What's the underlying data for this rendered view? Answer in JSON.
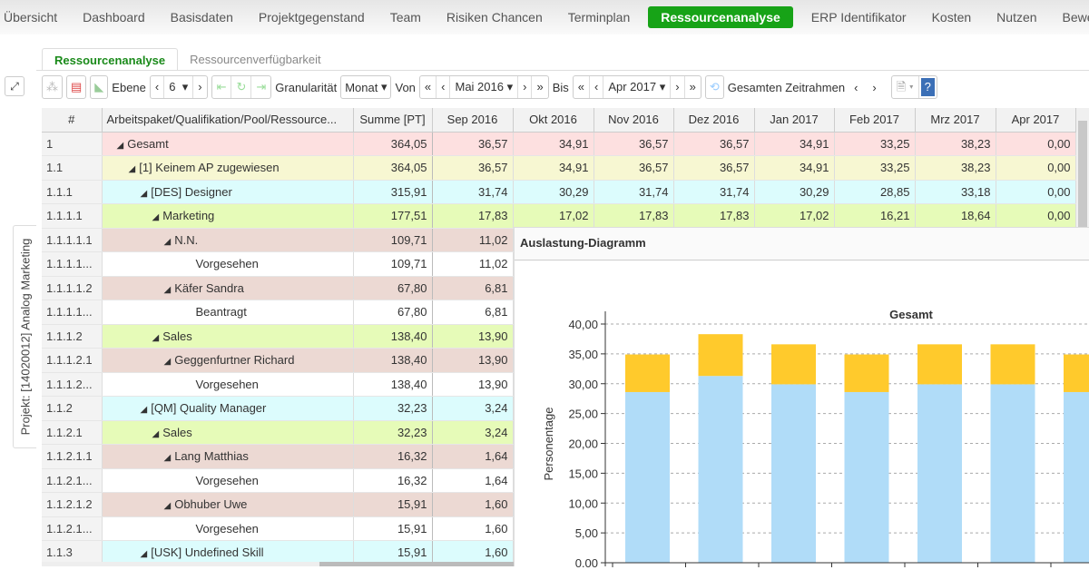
{
  "nav": {
    "items": [
      "Übersicht",
      "Dashboard",
      "Basisdaten",
      "Projektgegenstand",
      "Team",
      "Risiken Chancen",
      "Terminplan",
      "Ressourcenanalyse",
      "ERP Identifikator",
      "Kosten",
      "Nutzen",
      "Bewertung"
    ],
    "active": "Ressourcenanalyse",
    "accent": "#17a317"
  },
  "subtabs": [
    "Ressourcenanalyse",
    "Ressourcenverfügbarkeit"
  ],
  "toolbar": {
    "ebene_label": "Ebene",
    "ebene_value": "6",
    "granularitaet_label": "Granularität",
    "granularitaet_value": "Monat",
    "von_label": "Von",
    "von_value": "Mai 2016",
    "bis_label": "Bis",
    "bis_value": "Apr 2017",
    "zeitrahmen_label": "Gesamten Zeitrahmen"
  },
  "side_tab": "Projekt: [14020012] Analog Marketing",
  "table": {
    "headers": [
      "#",
      "Arbeitspaket/Qualifikation/Pool/Ressource...",
      "Summe [PT]",
      "Sep 2016",
      "Okt 2016",
      "Nov 2016",
      "Dez 2016",
      "Jan 2017",
      "Feb 2017",
      "Mrz 2017",
      "Apr 2017"
    ],
    "rows": [
      {
        "id": "1",
        "name": "Gesamt",
        "level": 0,
        "type": 0,
        "values": [
          "364,05",
          "36,57",
          "34,91",
          "36,57",
          "36,57",
          "34,91",
          "33,25",
          "38,23",
          "0,00"
        ]
      },
      {
        "id": "1.1",
        "name": "[1] Keinem AP zugewiesen",
        "level": 1,
        "type": 1,
        "values": [
          "364,05",
          "36,57",
          "34,91",
          "36,57",
          "36,57",
          "34,91",
          "33,25",
          "38,23",
          "0,00"
        ]
      },
      {
        "id": "1.1.1",
        "name": "[DES] Designer",
        "level": 2,
        "type": 2,
        "values": [
          "315,91",
          "31,74",
          "30,29",
          "31,74",
          "31,74",
          "30,29",
          "28,85",
          "33,18",
          "0,00"
        ]
      },
      {
        "id": "1.1.1.1",
        "name": "Marketing",
        "level": 3,
        "type": 3,
        "values": [
          "177,51",
          "17,83",
          "17,02",
          "17,83",
          "17,83",
          "17,02",
          "16,21",
          "18,64",
          "0,00"
        ]
      },
      {
        "id": "1.1.1.1.1",
        "name": "N.N.",
        "level": 4,
        "type": 4,
        "values": [
          "109,71",
          "11,02"
        ]
      },
      {
        "id": "1.1.1.1...",
        "name": "Vorgesehen",
        "level": 5,
        "type": 5,
        "values": [
          "109,71",
          "11,02"
        ]
      },
      {
        "id": "1.1.1.1.2",
        "name": "Käfer Sandra",
        "level": 4,
        "type": 4,
        "values": [
          "67,80",
          "6,81"
        ]
      },
      {
        "id": "1.1.1.1...",
        "name": "Beantragt",
        "level": 5,
        "type": 5,
        "values": [
          "67,80",
          "6,81"
        ]
      },
      {
        "id": "1.1.1.2",
        "name": "Sales",
        "level": 3,
        "type": 3,
        "values": [
          "138,40",
          "13,90"
        ]
      },
      {
        "id": "1.1.1.2.1",
        "name": "Geggenfurtner Richard",
        "level": 4,
        "type": 4,
        "values": [
          "138,40",
          "13,90"
        ]
      },
      {
        "id": "1.1.1.2...",
        "name": "Vorgesehen",
        "level": 5,
        "type": 5,
        "values": [
          "138,40",
          "13,90"
        ]
      },
      {
        "id": "1.1.2",
        "name": "[QM] Quality Manager",
        "level": 2,
        "type": 2,
        "values": [
          "32,23",
          "3,24"
        ]
      },
      {
        "id": "1.1.2.1",
        "name": "Sales",
        "level": 3,
        "type": 3,
        "values": [
          "32,23",
          "3,24"
        ]
      },
      {
        "id": "1.1.2.1.1",
        "name": "Lang Matthias",
        "level": 4,
        "type": 4,
        "values": [
          "16,32",
          "1,64"
        ]
      },
      {
        "id": "1.1.2.1...",
        "name": "Vorgesehen",
        "level": 5,
        "type": 5,
        "values": [
          "16,32",
          "1,64"
        ]
      },
      {
        "id": "1.1.2.1.2",
        "name": "Obhuber Uwe",
        "level": 4,
        "type": 4,
        "values": [
          "15,91",
          "1,60"
        ]
      },
      {
        "id": "1.1.2.1...",
        "name": "Vorgesehen",
        "level": 5,
        "type": 5,
        "values": [
          "15,91",
          "1,60"
        ]
      },
      {
        "id": "1.1.3",
        "name": "[USK] Undefined Skill",
        "level": 2,
        "type": 2,
        "values": [
          "15,91",
          "1,60"
        ]
      }
    ]
  },
  "chart_panel": {
    "title": "Auslastung-Diagramm"
  },
  "chart_data": {
    "type": "bar",
    "stacked": true,
    "title": "Gesamt",
    "xlabel": "",
    "ylabel": "Personentage",
    "ylim": [
      0,
      40
    ],
    "yticks": [
      "0,00",
      "5,00",
      "10,00",
      "15,00",
      "20,00",
      "25,00",
      "30,00",
      "35,00",
      "40,00"
    ],
    "grid": true,
    "series": [
      {
        "values": [
          28.6,
          31.3,
          29.9,
          28.6,
          29.9,
          29.9,
          28.6
        ],
        "color": "#b0dcf8"
      },
      {
        "values": [
          6.3,
          7.0,
          6.7,
          6.3,
          6.7,
          6.7,
          6.3
        ],
        "color": "#ffca2c"
      }
    ]
  }
}
